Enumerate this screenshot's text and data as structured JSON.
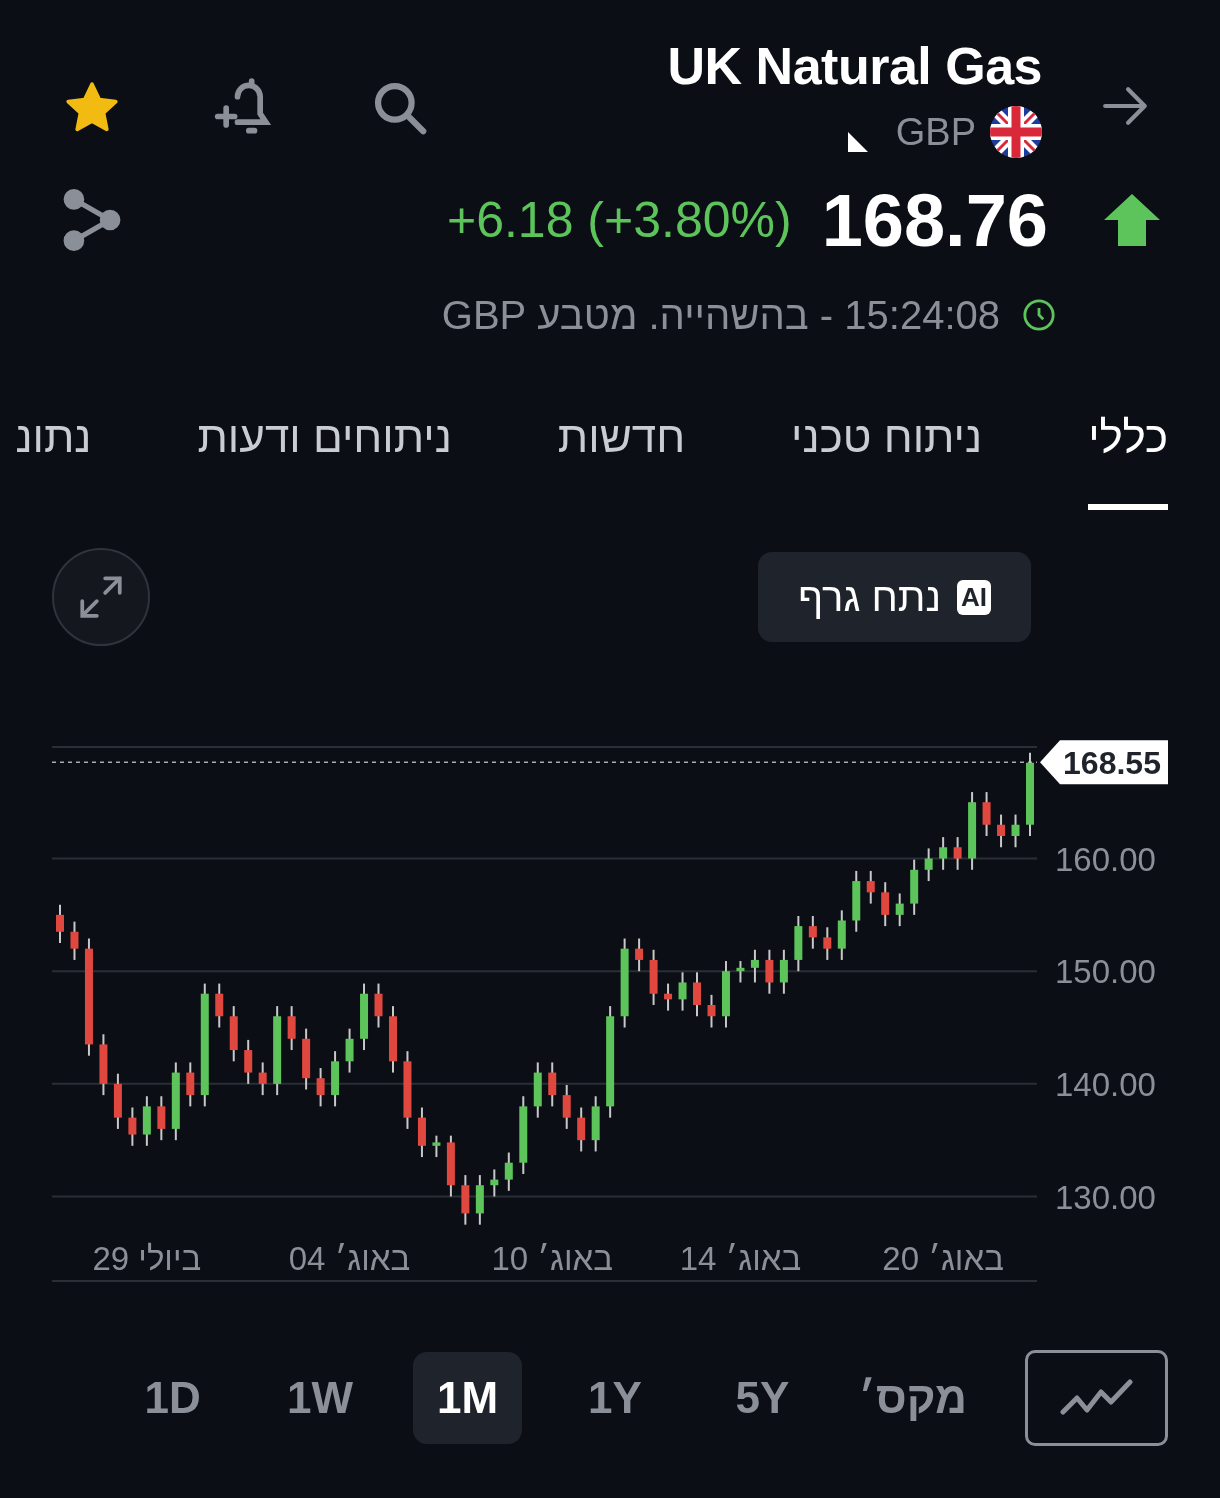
{
  "header": {
    "favorite": true,
    "title": "UK Natural Gas",
    "currency": "GBP"
  },
  "quote": {
    "change": "+6.18 (+3.80%)",
    "price": "168.76",
    "rising": true,
    "status": "15:24:08 - בהשהייה. מטבע GBP"
  },
  "tabs": [
    {
      "label": "כללי",
      "selected": true
    },
    {
      "label": "ניתוח טכני",
      "selected": false
    },
    {
      "label": "חדשות",
      "selected": false
    },
    {
      "label": "ניתוחים ודעות",
      "selected": false
    },
    {
      "label": "נתונ",
      "selected": false
    }
  ],
  "ai_button": {
    "badge": "AI",
    "label": "נתח גרף"
  },
  "chart": {
    "chart_data": {
      "type": "candlestick",
      "categories": [
        null,
        null,
        null,
        null,
        null,
        null,
        "29 ביולי",
        null,
        null,
        null,
        null,
        null,
        null,
        null,
        null,
        null,
        null,
        null,
        null,
        null,
        "04 באוג׳",
        null,
        null,
        null,
        null,
        null,
        null,
        null,
        null,
        null,
        null,
        null,
        null,
        null,
        "10 באוג׳",
        null,
        null,
        null,
        null,
        null,
        null,
        null,
        null,
        null,
        null,
        null,
        null,
        "14 באוג׳",
        null,
        null,
        null,
        null,
        null,
        null,
        null,
        null,
        null,
        null,
        null,
        null,
        null,
        "20 באוג׳",
        null,
        null,
        null,
        null,
        null,
        null
      ],
      "ylim": [
        122.5,
        169.9
      ],
      "grid": true,
      "ref_lines": [
        {
          "axis": "y",
          "value": 168.55,
          "label": "168.55"
        }
      ],
      "yticks": [
        {
          "value": 160,
          "label": "160.00"
        },
        {
          "value": 150,
          "label": "150.00"
        },
        {
          "value": 140,
          "label": "140.00"
        },
        {
          "value": 130,
          "label": "130.00"
        }
      ],
      "ohlc": [
        [
          155,
          155.9,
          152.5,
          153.5
        ],
        [
          153.5,
          154.4,
          151,
          152
        ],
        [
          152,
          152.9,
          142.5,
          143.5
        ],
        [
          143.5,
          144.4,
          139,
          140
        ],
        [
          140,
          140.9,
          136,
          137
        ],
        [
          137,
          137.9,
          134.5,
          135.5
        ],
        [
          135.5,
          138.9,
          134.5,
          138
        ],
        [
          138,
          138.9,
          135,
          136
        ],
        [
          136,
          141.9,
          135,
          141
        ],
        [
          141,
          141.9,
          138,
          139
        ],
        [
          139,
          148.9,
          138,
          148
        ],
        [
          148,
          148.9,
          145,
          146
        ],
        [
          146,
          146.9,
          142,
          143
        ],
        [
          143,
          143.9,
          140,
          141
        ],
        [
          141,
          141.9,
          139,
          140
        ],
        [
          140,
          146.9,
          139,
          146
        ],
        [
          146,
          146.9,
          143,
          144
        ],
        [
          144,
          144.9,
          139.5,
          140.5
        ],
        [
          140.5,
          141.4,
          138,
          139
        ],
        [
          139,
          142.9,
          138,
          142
        ],
        [
          142,
          144.9,
          141,
          144
        ],
        [
          144,
          148.9,
          143,
          148
        ],
        [
          148,
          148.9,
          145,
          146
        ],
        [
          146,
          146.9,
          141,
          142
        ],
        [
          142,
          142.9,
          136,
          137
        ],
        [
          137,
          137.9,
          133.5,
          134.5
        ],
        [
          134.5,
          135.4,
          133.5,
          134.8
        ],
        [
          134.8,
          135.4,
          130,
          131
        ],
        [
          131,
          131.9,
          127.5,
          128.5
        ],
        [
          128.5,
          131.9,
          127.5,
          131
        ],
        [
          131,
          132.4,
          130,
          131.5
        ],
        [
          131.5,
          133.9,
          130.5,
          133
        ],
        [
          133,
          138.9,
          132,
          138
        ],
        [
          138,
          141.9,
          137,
          141
        ],
        [
          141,
          141.9,
          138,
          139
        ],
        [
          139,
          139.9,
          136,
          137
        ],
        [
          137,
          137.9,
          134,
          135
        ],
        [
          135,
          138.9,
          134,
          138
        ],
        [
          138,
          146.9,
          137,
          146
        ],
        [
          146,
          152.9,
          145,
          152
        ],
        [
          152,
          152.9,
          150,
          151
        ],
        [
          151,
          151.9,
          147,
          148
        ],
        [
          148,
          148.9,
          146.5,
          147.5
        ],
        [
          147.5,
          149.9,
          146.5,
          149
        ],
        [
          149,
          149.9,
          146,
          147
        ],
        [
          147,
          147.9,
          145,
          146
        ],
        [
          146,
          150.9,
          145,
          150
        ],
        [
          150,
          150.9,
          149,
          150.3
        ],
        [
          150.3,
          151.9,
          149,
          151
        ],
        [
          151,
          151.9,
          148,
          149
        ],
        [
          149,
          151.9,
          148,
          151
        ],
        [
          151,
          154.9,
          150,
          154
        ],
        [
          154,
          154.9,
          152,
          153
        ],
        [
          153,
          153.9,
          151,
          152
        ],
        [
          152,
          155.4,
          151,
          154.5
        ],
        [
          154.5,
          158.9,
          153.5,
          158
        ],
        [
          158,
          158.9,
          156,
          157
        ],
        [
          157,
          157.9,
          154,
          155
        ],
        [
          155,
          156.9,
          154,
          156
        ],
        [
          156,
          159.9,
          155,
          159
        ],
        [
          159,
          160.9,
          158,
          160
        ],
        [
          160,
          161.9,
          159,
          161
        ],
        [
          161,
          161.9,
          159,
          160
        ],
        [
          160,
          165.9,
          159,
          165
        ],
        [
          165,
          165.9,
          162,
          163
        ],
        [
          163,
          163.9,
          161,
          162
        ],
        [
          162,
          163.9,
          161,
          163
        ],
        [
          163,
          169.4,
          162,
          168.5
        ]
      ]
    }
  },
  "ranges": [
    {
      "label": "מקס׳",
      "selected": false
    },
    {
      "label": "5Y",
      "selected": false
    },
    {
      "label": "1Y",
      "selected": false
    },
    {
      "label": "1M",
      "selected": true
    },
    {
      "label": "1W",
      "selected": false
    },
    {
      "label": "1D",
      "selected": false
    }
  ]
}
